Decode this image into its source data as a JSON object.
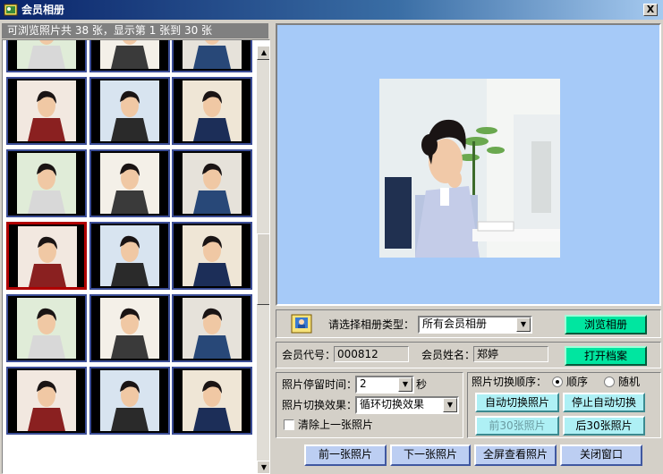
{
  "window": {
    "title": "会员相册",
    "close_symbol": "X"
  },
  "info_bar": "可浏览照片共 38 张，显示第 1 张到 30 张",
  "thumbnails": {
    "count_visible": 18,
    "selected_index": 9
  },
  "album_type": {
    "label": "请选择相册类型：",
    "selected": "所有会员相册",
    "browse_button": "浏览相册"
  },
  "member": {
    "id_label": "会员代号：",
    "id_value": "000812",
    "name_label": "会员姓名：",
    "name_value": "郑婷",
    "open_file_button": "打开档案"
  },
  "slideshow": {
    "stay_label": "照片停留时间：",
    "stay_value": "2",
    "stay_unit": "秒",
    "effect_label": "照片切换效果：",
    "effect_value": "循环切换效果",
    "clear_prev_label": "清除上一张照片",
    "clear_prev_checked": false,
    "order_label": "照片切换顺序：",
    "order_options": [
      "顺序",
      "随机"
    ],
    "order_selected": "顺序",
    "auto_switch_button": "自动切换照片",
    "stop_auto_button": "停止自动切换",
    "prev30_button": "前30张照片",
    "next30_button": "后30张照片"
  },
  "bottom_buttons": {
    "prev": "前一张照片",
    "next": "下一张照片",
    "fullscreen": "全屏查看照片",
    "close": "关闭窗口"
  },
  "colors": {
    "title_bar": "#0a246a",
    "preview_bg": "#a6caf8",
    "thumb_border": "#3b4d96",
    "selected_border": "#b00000",
    "accent_green": "#00e6a0",
    "accent_cyan": "#aef0f5"
  }
}
